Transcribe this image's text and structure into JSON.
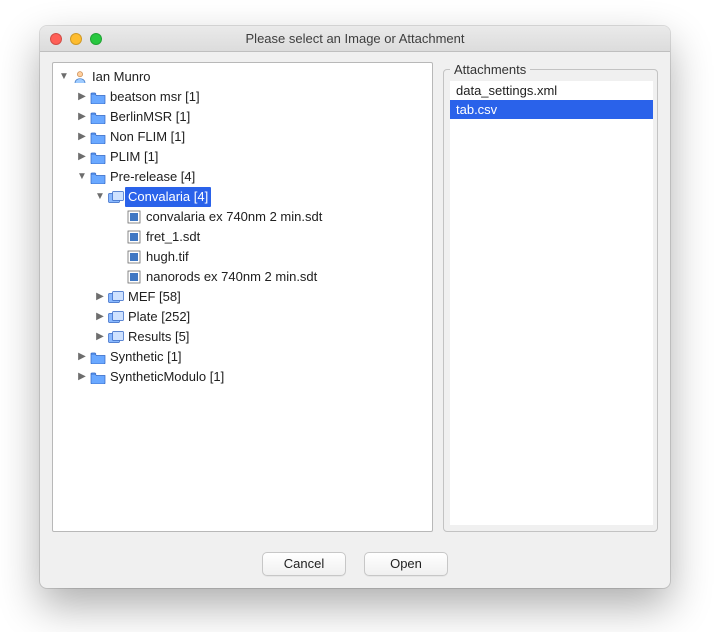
{
  "window": {
    "title": "Please select an Image or Attachment"
  },
  "tree": {
    "root": {
      "label": "Ian Munro"
    },
    "projects": {
      "beatson": {
        "label": "beatson msr [1]"
      },
      "berlin": {
        "label": "BerlinMSR [1]"
      },
      "nonflim": {
        "label": "Non FLIM [1]"
      },
      "plim": {
        "label": "PLIM [1]"
      },
      "prerelease": {
        "label": "Pre-release [4]"
      },
      "synthetic": {
        "label": "Synthetic [1]"
      },
      "synmod": {
        "label": "SyntheticModulo [1]"
      }
    },
    "datasets": {
      "convalaria": {
        "label": "Convalaria [4]"
      },
      "mef": {
        "label": "MEF [58]"
      },
      "plate": {
        "label": "Plate [252]"
      },
      "results": {
        "label": "Results [5]"
      }
    },
    "images": {
      "img1": {
        "label": "convalaria ex 740nm 2 min.sdt"
      },
      "img2": {
        "label": "fret_1.sdt"
      },
      "img3": {
        "label": "hugh.tif"
      },
      "img4": {
        "label": "nanorods ex 740nm 2 min.sdt"
      }
    }
  },
  "attachments": {
    "legend": "Attachments",
    "items": {
      "a0": "data_settings.xml",
      "a1": "tab.csv"
    }
  },
  "buttons": {
    "cancel": "Cancel",
    "open": "Open"
  },
  "icons": {
    "user": "user-icon",
    "project": "folder-icon",
    "dataset": "dataset-icon",
    "image": "image-file-icon"
  }
}
